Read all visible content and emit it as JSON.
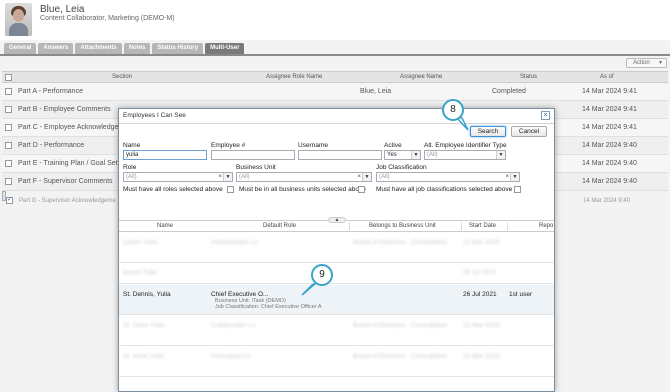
{
  "employee": {
    "name": "Blue, Leia",
    "subtitle": "Content Collaborator, Marketing (DEMO-M)"
  },
  "tabs": [
    "General",
    "Answers",
    "Attachments",
    "Notes",
    "Status History",
    "Multi-User"
  ],
  "action_label": "Action",
  "grid": {
    "headers": {
      "section": "Section",
      "role": "Assignee Role Name",
      "name": "Assignee Name",
      "status": "Status",
      "asof": "As of"
    },
    "rows": [
      {
        "section": "Part A - Performance",
        "name": "Blue, Leia",
        "status": "Completed",
        "asof": "14 Mar 2024 9:41"
      },
      {
        "section": "Part B - Employee Comments",
        "name": "",
        "status": "",
        "asof": "14 Mar 2024 9:41"
      },
      {
        "section": "Part C - Employee Acknowledgeme",
        "name": "",
        "status": "",
        "asof": "14 Mar 2024 9:41"
      },
      {
        "section": "Part D - Performance",
        "name": "",
        "status": "",
        "asof": "14 Mar 2024 9:40"
      },
      {
        "section": "Part E - Training Plan / Goal Setting",
        "name": "",
        "status": "",
        "asof": "14 Mar 2024 9:40"
      },
      {
        "section": "Part F - Supervisor Comments",
        "name": "",
        "status": "",
        "asof": "14 Mar 2024 9:40"
      },
      {
        "section": "Part G - Supervisor Acknowledgeme",
        "name": "",
        "status": "",
        "asof": "14 Mar 2024 9:40"
      }
    ]
  },
  "dialog": {
    "title": "Employees I Can See",
    "close": "×",
    "search_btn": "Search",
    "cancel_btn": "Cancel",
    "labels": {
      "name": "Name",
      "emp_num": "Employee #",
      "username": "Username",
      "active": "Active",
      "alt_id": "Alt. Employee Identifier Type",
      "role": "Role",
      "bu": "Business Unit",
      "jc": "Job Classification",
      "must_roles": "Must have all roles selected above",
      "must_bu": "Must be in all business units selected above",
      "must_jc": "Must have all job classifications selected above"
    },
    "values": {
      "name": "yulia",
      "active": "Yes",
      "alt_id": "(All)",
      "role": "(All)",
      "bu": "(All)",
      "jc": "(All)"
    },
    "results": {
      "headers": {
        "name": "Name",
        "role": "Default Role",
        "bu": "Belongs to Business Unit",
        "start": "Start Date",
        "rep": "Repo"
      },
      "blurred": [
        {
          "name": "Lorem Yulia",
          "role": "Administrator Lo",
          "bu": "Board of Directors - Consultation",
          "start": "12 Mar 2024"
        },
        {
          "name": "Ipsum Yulia",
          "role": "",
          "bu": "",
          "start": "26 Jul 2021"
        },
        {
          "name": "St. Dolor Yulia",
          "role": "Collaborator Lo",
          "bu": "Board of Directors - Consultation",
          "start": "12 Mar 2024"
        },
        {
          "name": "St. Amet Yulia",
          "role": "Participant Lo",
          "bu": "Board of Directors - Consultation",
          "start": "12 Mar 2024"
        }
      ],
      "highlight": {
        "name": "St. Dennis, Yulia",
        "role": "Chief Executive O...",
        "bu_line": "Business Unit: iTask (DEMO)",
        "jc_line": "Job Classification: Chief Executive Officer A",
        "start": "26 Jul 2021",
        "rep": "1st user"
      }
    }
  },
  "callouts": {
    "c8": "8",
    "c9": "9"
  },
  "colors": {
    "accent": "#3aa3c8",
    "tab_active": "#7a7a7a",
    "tab": "#b6b6b6"
  }
}
